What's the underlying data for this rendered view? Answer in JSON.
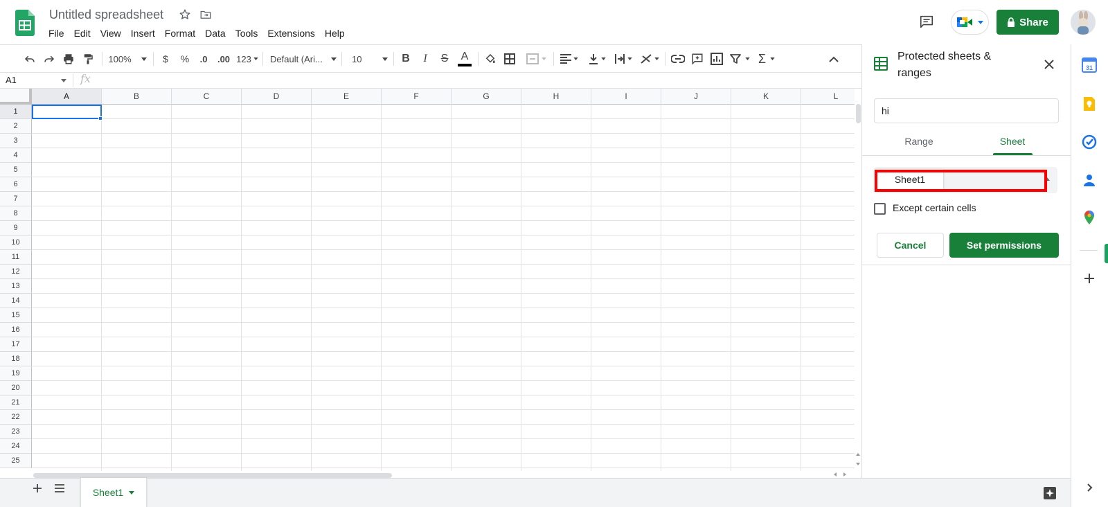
{
  "app": {
    "doc_title": "Untitled spreadsheet",
    "menu": [
      "File",
      "Edit",
      "View",
      "Insert",
      "Format",
      "Data",
      "Tools",
      "Extensions",
      "Help"
    ],
    "share_label": "Share"
  },
  "toolbar": {
    "zoom": "100%",
    "currency": "$",
    "percent": "%",
    "dec_decrease": ".0",
    "dec_increase": ".00",
    "number_format": "123",
    "font_family": "Default (Ari...",
    "font_size": "10",
    "bold": "B",
    "italic": "I",
    "strike": "S",
    "text_color": "A",
    "functions": "Σ"
  },
  "formula_bar": {
    "cell_ref": "A1",
    "fx": "fx"
  },
  "grid": {
    "columns": [
      "A",
      "B",
      "C",
      "D",
      "E",
      "F",
      "G",
      "H",
      "I",
      "J",
      "K",
      "L"
    ],
    "rows": [
      "1",
      "2",
      "3",
      "4",
      "5",
      "6",
      "7",
      "8",
      "9",
      "10",
      "11",
      "12",
      "13",
      "14",
      "15",
      "16",
      "17",
      "18",
      "19",
      "20",
      "21",
      "22",
      "23",
      "24",
      "25"
    ],
    "selected_cell": "A1"
  },
  "sheets": {
    "tabs": [
      {
        "label": "Sheet1",
        "active": true
      }
    ]
  },
  "panel": {
    "title": "Protected sheets & ranges",
    "description_value": "hi",
    "tabs": [
      "Range",
      "Sheet"
    ],
    "active_tab": "Sheet",
    "sheet_option": "Sheet1",
    "except_label": "Except certain cells",
    "except_checked": false,
    "cancel_label": "Cancel",
    "set_permissions_label": "Set permissions"
  },
  "colors": {
    "accent_green": "#188038",
    "selection_blue": "#1a73e8",
    "highlight_red": "#ff0000"
  }
}
